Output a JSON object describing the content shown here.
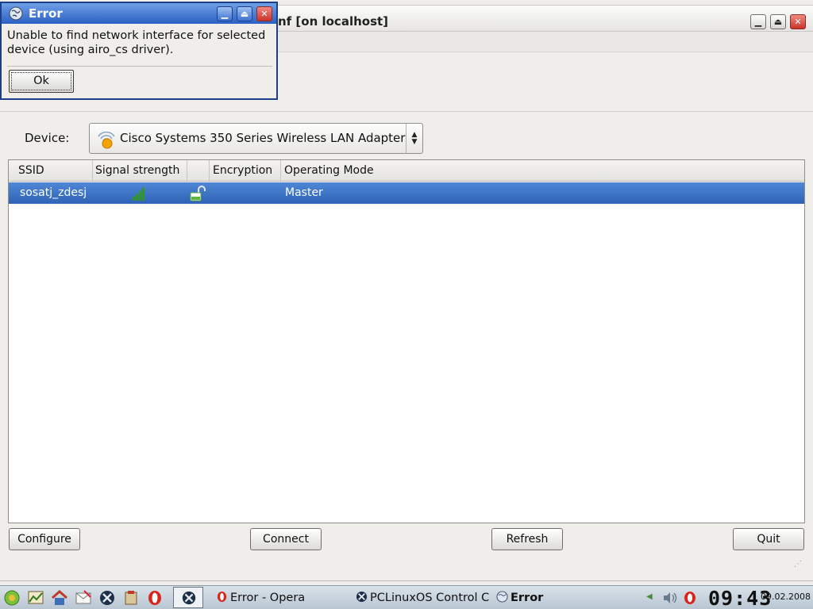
{
  "main_window": {
    "title": "nf [on localhost]",
    "device_label": "Device:",
    "device_value": "Cisco Systems 350 Series Wireless LAN Adapter",
    "table": {
      "columns": [
        "SSID",
        "Signal strength",
        "",
        "Encryption",
        "Operating Mode"
      ],
      "rows": [
        {
          "ssid": "sosatj_zdesj",
          "signal_icon": "signal-bars-icon",
          "lock_icon": "lock-open-icon",
          "encryption": "",
          "mode": "Master"
        }
      ]
    },
    "buttons": {
      "configure": "Configure",
      "connect": "Connect",
      "refresh": "Refresh",
      "quit": "Quit"
    },
    "window_controls": {
      "minimize": "▁",
      "maximize": "⏏",
      "close": "✕"
    }
  },
  "error_dialog": {
    "title": "Error",
    "message": "Unable to find network interface for selected device (using airo_cs driver).",
    "ok_label": "Ok"
  },
  "taskbar": {
    "tasks": [
      {
        "label": "Error - Opera",
        "icon": "opera-icon"
      },
      {
        "label": "PCLinuxOS Control C",
        "icon": "control-center-icon"
      },
      {
        "label": "Error",
        "icon": "globe-icon"
      }
    ],
    "clock_time": "09:43",
    "clock_date": "09.02.2008"
  },
  "colors": {
    "selection": "#3a6fc4",
    "titlebar_active": "#2b60c4",
    "close_button": "#c9332a"
  }
}
